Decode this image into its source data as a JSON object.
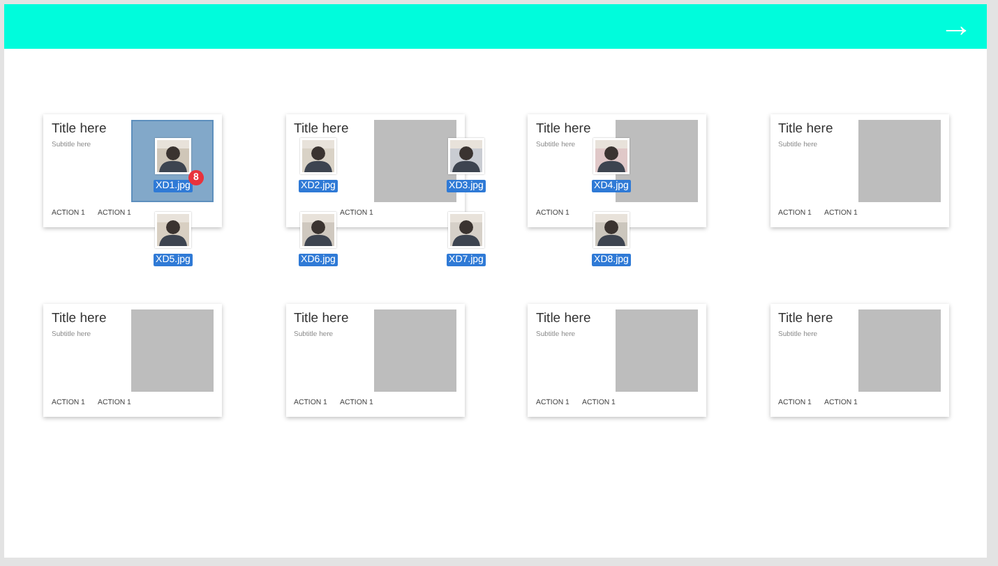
{
  "header": {
    "arrow": "→"
  },
  "cards": [
    {
      "title": "Title here",
      "subtitle": "Subtitle here",
      "highlighted": true,
      "actions": [
        "ACTION 1",
        "ACTION 1"
      ]
    },
    {
      "title": "Title here",
      "highlighted": false,
      "first_action_hidden": true,
      "actions": [
        "ACTION 1"
      ]
    },
    {
      "title": "Title here",
      "subtitle": "Subtitle here",
      "highlighted": false,
      "actions": [
        "ACTION 1"
      ]
    },
    {
      "title": "Title here",
      "subtitle": "Subtitle here",
      "highlighted": false,
      "actions": [
        "ACTION 1",
        "ACTION 1"
      ]
    },
    {
      "title": "Title here",
      "subtitle": "Subtitle here",
      "highlighted": false,
      "actions": [
        "ACTION 1",
        "ACTION 1"
      ]
    },
    {
      "title": "Title here",
      "subtitle": "Subtitle here",
      "highlighted": false,
      "actions": [
        "ACTION 1",
        "ACTION 1"
      ]
    },
    {
      "title": "Title here",
      "subtitle": "Subtitle here",
      "highlighted": false,
      "actions": [
        "ACTION 1",
        "ACTION 1"
      ]
    },
    {
      "title": "Title here",
      "subtitle": "Subtitle here",
      "highlighted": false,
      "actions": [
        "ACTION 1",
        "ACTION 1"
      ]
    }
  ],
  "files": [
    {
      "name": "XD1.jpg",
      "badge": "8"
    },
    {
      "name": "XD2.jpg"
    },
    {
      "name": "XD3.jpg"
    },
    {
      "name": "XD4.jpg"
    },
    {
      "name": "XD5.jpg"
    },
    {
      "name": "XD6.jpg"
    },
    {
      "name": "XD7.jpg"
    },
    {
      "name": "XD8.jpg"
    }
  ]
}
